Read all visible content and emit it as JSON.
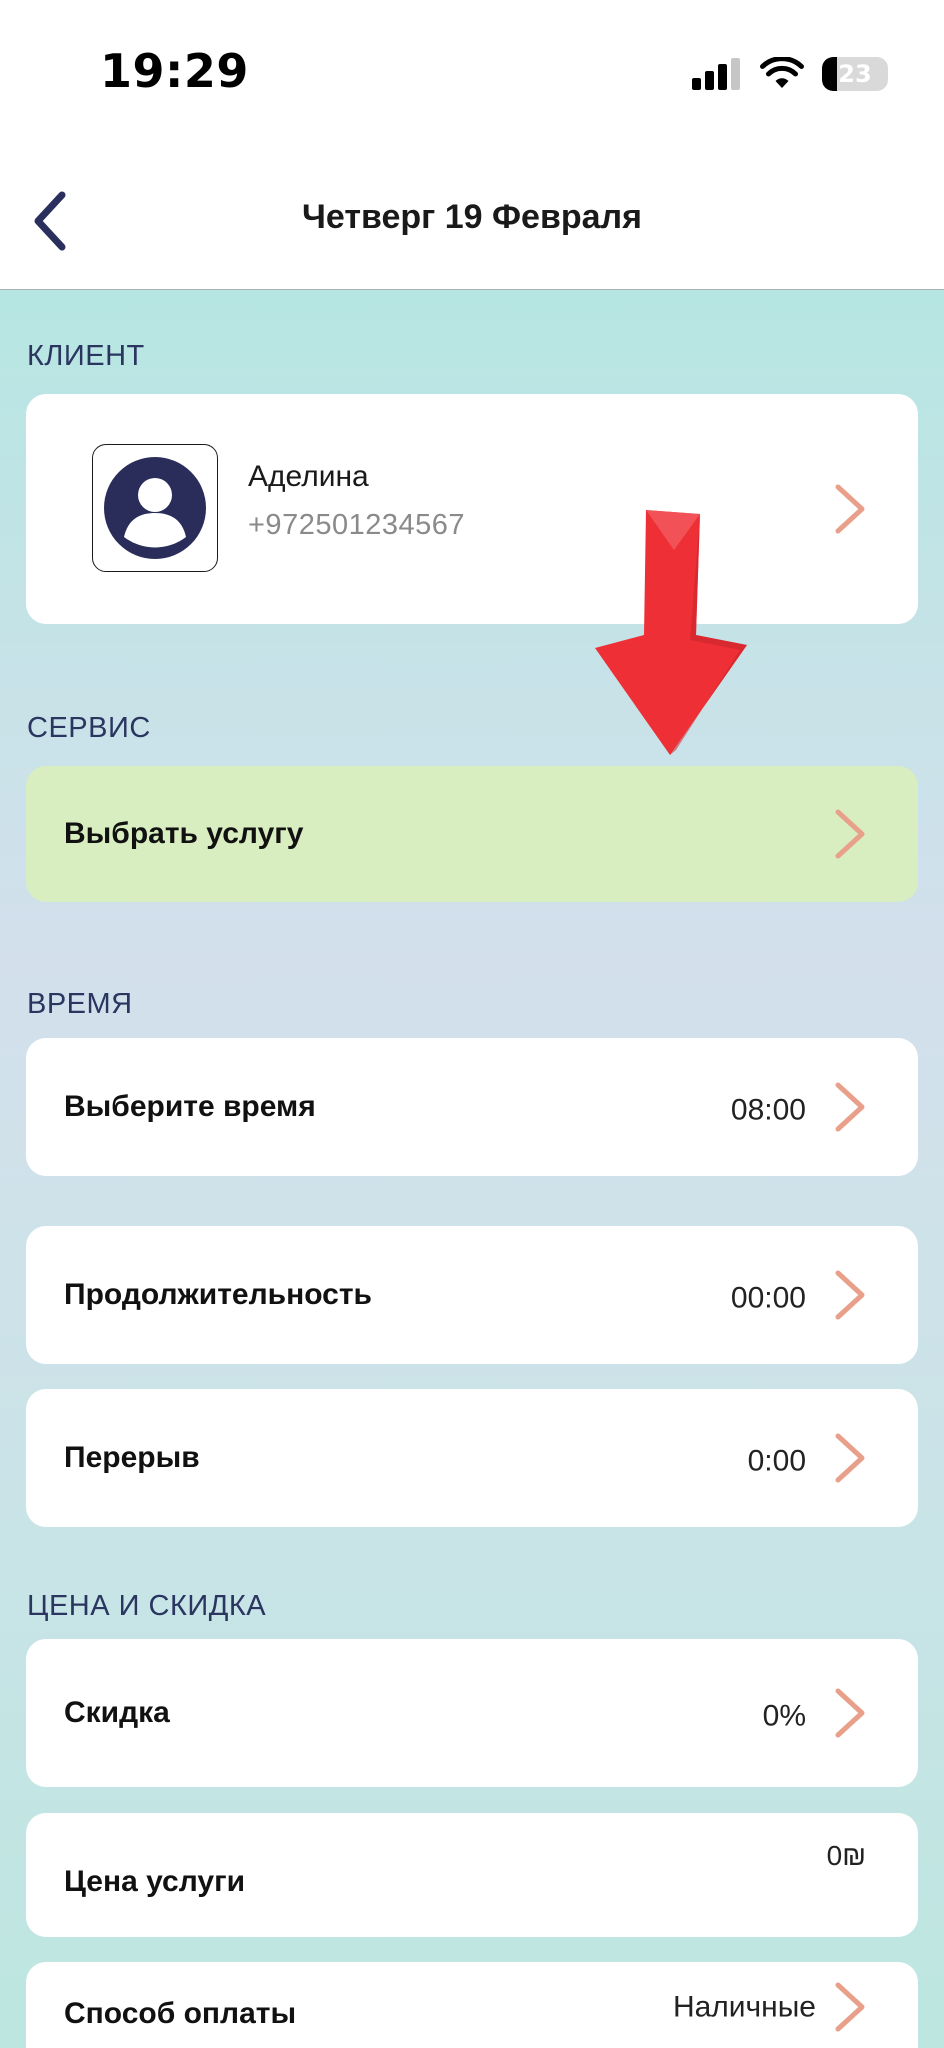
{
  "status_bar": {
    "time": "19:29",
    "battery_level": "23",
    "battery_percent": 23,
    "icons": [
      "cellular-signal-icon",
      "wifi-icon",
      "battery-icon"
    ]
  },
  "nav": {
    "title": "Четверг 19 Февраля",
    "back_icon": "chevron-left-icon"
  },
  "sections": {
    "client_label": "КЛИЕНТ",
    "service_label": "СЕРВИС",
    "time_label": "ВРЕМЯ",
    "price_label": "ЦЕНА И СКИДКА"
  },
  "client": {
    "name": "Аделина",
    "phone": "+972501234567",
    "avatar_icon": "user-avatar-icon"
  },
  "service": {
    "select_label": "Выбрать услугу"
  },
  "time": {
    "select_time_label": "Выберите время",
    "select_time_value": "08:00",
    "duration_label": "Продолжительность",
    "duration_value": "00:00",
    "break_label": "Перерыв",
    "break_value": "0:00"
  },
  "price": {
    "discount_label": "Скидка",
    "discount_value": "0%",
    "service_price_label": "Цена услуги",
    "service_price_value": "0₪",
    "payment_label": "Способ оплаты",
    "payment_value": "Наличные"
  },
  "colors": {
    "chevron": "#e8a08a",
    "back_chevron": "#2b2f5e",
    "highlight_card": "#d8eec0",
    "annotation_arrow": "#ee2f35",
    "section_label": "#2a3560"
  },
  "annotation": {
    "icon": "red-arrow-down-icon"
  }
}
